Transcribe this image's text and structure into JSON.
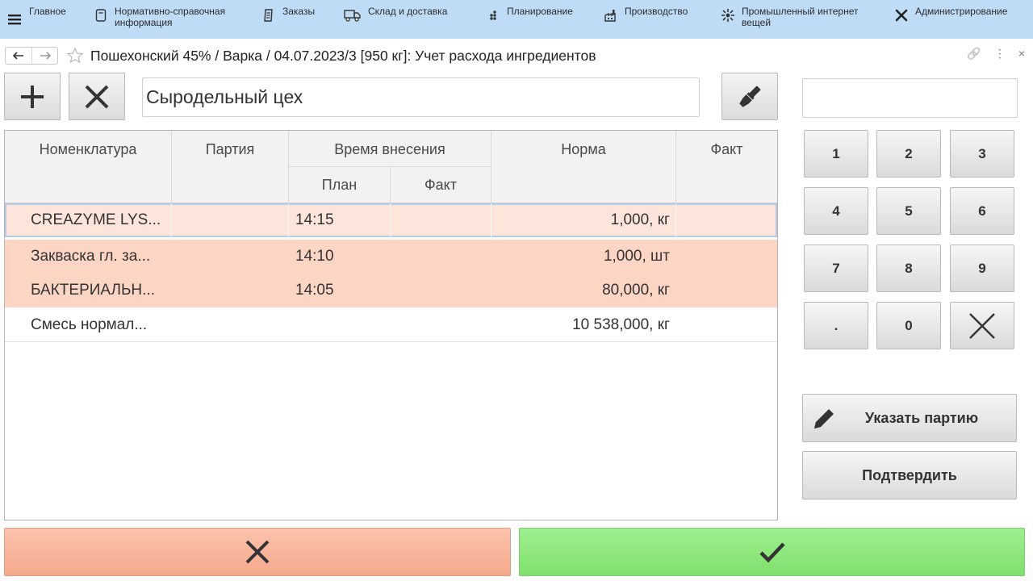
{
  "nav": {
    "items": [
      {
        "label": "Главное",
        "icon": "hamburger-icon"
      },
      {
        "label": "Нормативно-справочная\nинформация",
        "icon": "book-icon"
      },
      {
        "label": "Заказы",
        "icon": "orders-icon"
      },
      {
        "label": "Склад и доставка",
        "icon": "truck-icon"
      },
      {
        "label": "Планирование",
        "icon": "planning-icon"
      },
      {
        "label": "Производство",
        "icon": "factory-icon"
      },
      {
        "label": "Промышленный интернет\nвещей",
        "icon": "iot-icon"
      },
      {
        "label": "Администрирование",
        "icon": "tools-icon"
      }
    ]
  },
  "window": {
    "title": "Пошехонский 45% / Варка / 04.07.2023/3 [950 кг]: Учет расхода ингредиентов",
    "tools": [
      "🔗",
      "⋮",
      "×"
    ]
  },
  "toolbar": {
    "shop": "Сыродельный цех"
  },
  "table": {
    "headers": {
      "nomenclature": "Номенклатура",
      "batch": "Партия",
      "time": "Время внесения",
      "plan": "План",
      "fact_time": "Факт",
      "norm": "Норма",
      "fact": "Факт"
    },
    "rows": [
      {
        "nomenclature": "CREAZYME LYS...",
        "batch": "",
        "plan": "14:15",
        "fact_time": "",
        "norm": "1,000, кг",
        "fact": "",
        "style": "sel"
      },
      {
        "nomenclature": "Закваска гл. за...",
        "batch": "",
        "plan": "14:10",
        "fact_time": "",
        "norm": "1,000, шт",
        "fact": "",
        "style": "hl"
      },
      {
        "nomenclature": "БАКТЕРИАЛЬН...",
        "batch": "",
        "plan": "14:05",
        "fact_time": "",
        "norm": "80,000, кг",
        "fact": "",
        "style": "hl"
      },
      {
        "nomenclature": "Смесь нормал...",
        "batch": "",
        "plan": "",
        "fact_time": "",
        "norm": "10 538,000, кг",
        "fact": "",
        "style": "plain"
      }
    ]
  },
  "keypad": {
    "keys": [
      "1",
      "2",
      "3",
      "4",
      "5",
      "6",
      "7",
      "8",
      "9",
      ".",
      "0"
    ]
  },
  "actions": {
    "set_batch": "Указать партию",
    "confirm": "Подтвердить"
  },
  "colors": {
    "nav_bg": "#bfdcf6",
    "row_selected": "#fde5dc",
    "row_highlight": "#fdd5c5",
    "cancel": "#f6a98c",
    "ok": "#7fe06d"
  }
}
